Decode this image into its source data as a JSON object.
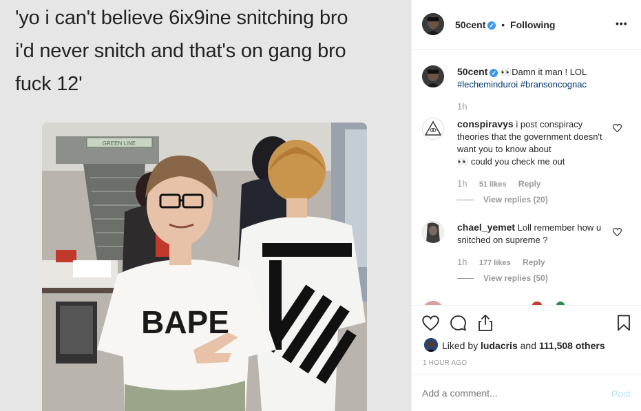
{
  "post": {
    "meme_caption": "'yo i can't believe 6ix9ine snitching bro\ni'd never snitch and that's on gang bro\nfuck 12'",
    "photo": {
      "sign_text": "GREEN LINE",
      "shirt_text": "BAPE"
    }
  },
  "header": {
    "username": "50cent",
    "separator": "•",
    "follow_status": "Following",
    "more_label": "•••"
  },
  "caption": {
    "username": "50cent",
    "emoji": "👀",
    "text": "Damn it man ! LOL",
    "hashtags": [
      "#lecheminduroi",
      "#bransoncognac"
    ],
    "time": "1h"
  },
  "comments": [
    {
      "username": "conspiravys",
      "text_line1": "i post conspiracy",
      "text_rest": "theories that the government doesn't want you to know about",
      "emoji": "👀",
      "text_tail": "could you check me out",
      "time": "1h",
      "likes": "51 likes",
      "reply_label": "Reply",
      "view_replies": "View replies (20)"
    },
    {
      "username": "chael_yemet",
      "text_line1": "Loll remember how",
      "text_rest": "u snitched on supreme ?",
      "time": "1h",
      "likes": "177 likes",
      "reply_label": "Reply",
      "view_replies": "View replies (50)"
    }
  ],
  "likes_line": {
    "prefix": "Liked by",
    "user": "ludacris",
    "and": "and",
    "count": "111,508 others"
  },
  "timestamp": "1 HOUR AGO",
  "add_comment": {
    "placeholder": "Add a comment...",
    "post_label": "Post"
  },
  "colors": {
    "link": "#003569",
    "verified": "#3897f0",
    "post_disabled": "#b2dffc",
    "muted": "#999999"
  },
  "icons": [
    "heart-icon",
    "comment-icon",
    "share-icon",
    "bookmark-icon",
    "verified-badge-icon",
    "more-options-icon"
  ]
}
